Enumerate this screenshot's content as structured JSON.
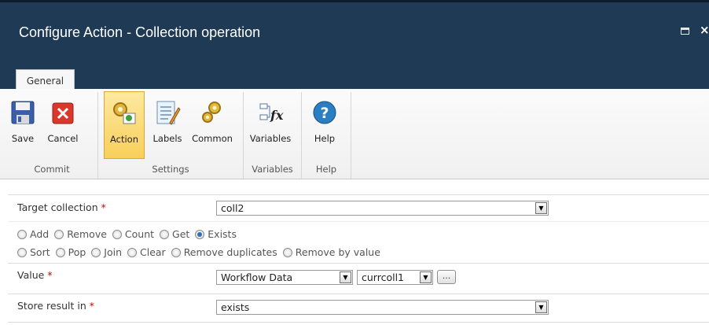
{
  "window": {
    "title": "Configure Action - Collection operation"
  },
  "tabs": [
    {
      "label": "General"
    }
  ],
  "ribbon": {
    "buttons": {
      "save": "Save",
      "cancel": "Cancel",
      "action": "Action",
      "labels": "Labels",
      "common": "Common",
      "variables": "Variables",
      "help": "Help"
    },
    "groups": {
      "commit": "Commit",
      "settings": "Settings",
      "variables": "Variables",
      "help": "Help"
    }
  },
  "form": {
    "target_collection": {
      "label": "Target collection",
      "required": "*",
      "value": "coll2"
    },
    "operations_row1": [
      "Add",
      "Remove",
      "Count",
      "Get",
      "Exists"
    ],
    "operations_row2": [
      "Sort",
      "Pop",
      "Join",
      "Clear",
      "Remove duplicates",
      "Remove by value"
    ],
    "selected_operation": "Exists",
    "value": {
      "label": "Value",
      "required": "*",
      "source": "Workflow Data",
      "variable": "currcoll1",
      "ellipsis": "..."
    },
    "store_result": {
      "label": "Store result in",
      "required": "*",
      "value": "exists"
    }
  }
}
